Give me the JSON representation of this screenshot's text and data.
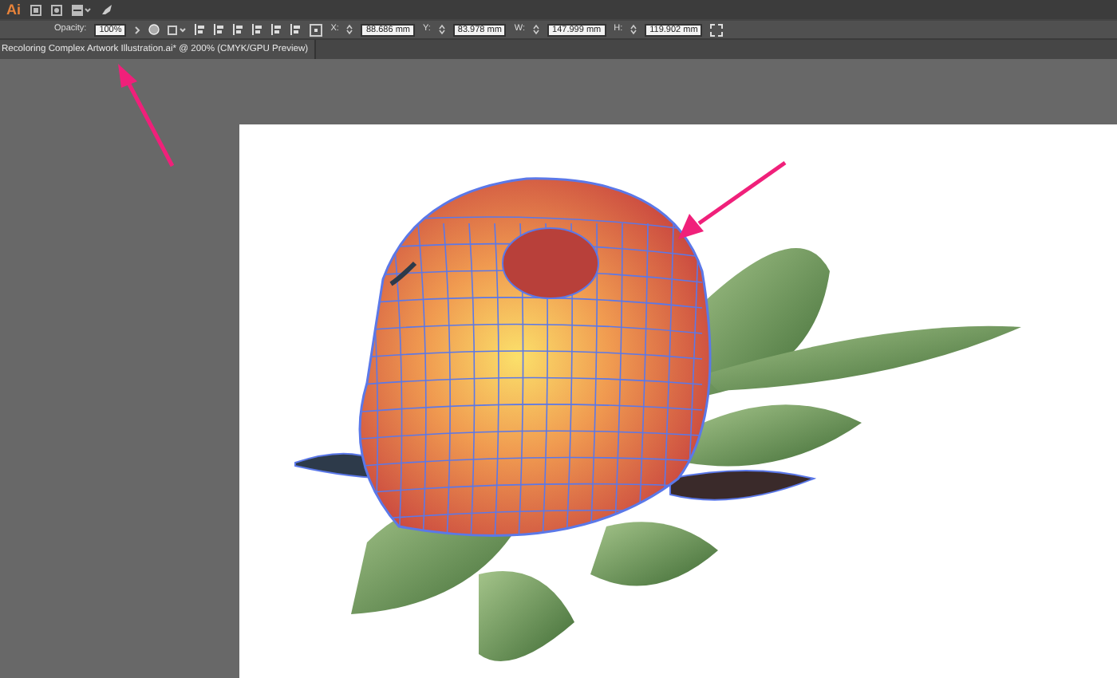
{
  "app": {
    "logo": "Ai"
  },
  "control_bar": {
    "opacity_label": "Opacity:",
    "opacity_value": "100%",
    "fields": [
      {
        "label": "X:",
        "value": "88.686 mm"
      },
      {
        "label": "Y:",
        "value": "83.978 mm"
      },
      {
        "label": "W:",
        "value": "147.999 mm"
      },
      {
        "label": "H:",
        "value": "119.902 mm"
      }
    ]
  },
  "document_tab": {
    "title": "Recoloring Complex Artwork Illustration.ai* @ 200% (CMYK/GPU Preview)"
  }
}
